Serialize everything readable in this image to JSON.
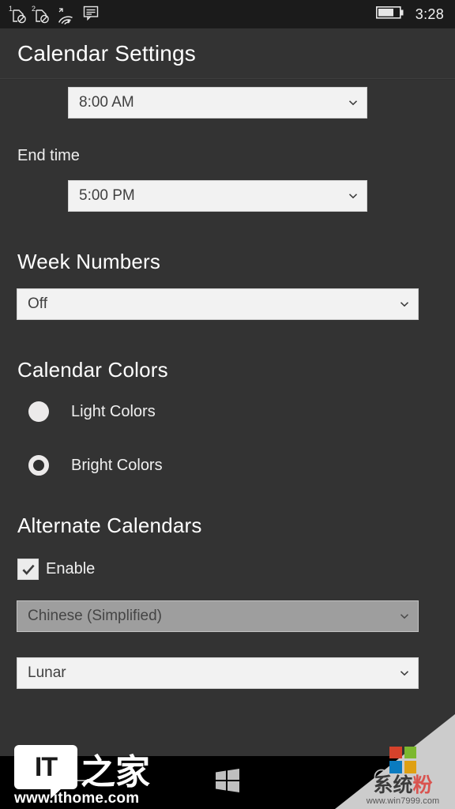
{
  "statusbar": {
    "sim1_label": "1",
    "sim2_label": "2",
    "icons": [
      "sim1-no-service-icon",
      "sim2-no-service-icon",
      "wifi-icon",
      "sms-icon"
    ],
    "battery": "battery-icon",
    "time": "3:28"
  },
  "header": {
    "title": "Calendar Settings"
  },
  "content": {
    "start_time": {
      "value": "8:00 AM"
    },
    "end_time": {
      "label": "End time",
      "value": "5:00 PM"
    },
    "week_numbers": {
      "title": "Week Numbers",
      "value": "Off"
    },
    "calendar_colors": {
      "title": "Calendar Colors",
      "options": [
        {
          "label": "Light Colors",
          "state": "unselected"
        },
        {
          "label": "Bright Colors",
          "state": "selected"
        }
      ]
    },
    "alternate_calendars": {
      "title": "Alternate Calendars",
      "enable_label": "Enable",
      "enable_checked": true,
      "language": {
        "value": "Chinese (Simplified)",
        "disabled": true
      },
      "calendar_type": {
        "value": "Lunar",
        "disabled": false
      }
    }
  },
  "navbar": {
    "back": "back-arrow-icon",
    "start": "windows-start-icon",
    "search": "search-icon"
  },
  "watermarks": {
    "ithome": {
      "badge": "IT",
      "cn": "之家",
      "url": "www.ithome.com"
    },
    "corner": {
      "cn": "系统",
      "cn_accent": "粉",
      "url": "www.win7999.com",
      "ms_colors": [
        "#d6422b",
        "#7ab породe",
        "#0a7bc0",
        "#dfa013"
      ]
    }
  },
  "colors": {
    "page_bg": "#333333",
    "statusbar_bg": "#1b1b1b",
    "navbar_bg": "#000000",
    "combo_bg": "#f2f2f2",
    "combo_disabled_bg": "#9e9e9e",
    "text": "#ffffff"
  }
}
